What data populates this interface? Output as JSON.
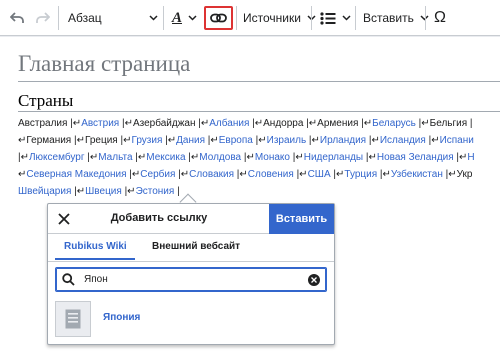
{
  "toolbar": {
    "undo_icon": "undo-arrow",
    "redo_icon": "redo-arrow",
    "format_label": "Абзац",
    "text_style_icon": "text-style-A",
    "link_icon": "link",
    "cite_label": "Источники",
    "list_icon": "bullet-list",
    "insert_label": "Вставить",
    "special_char_label": "Ω",
    "highlight_color": "#d33"
  },
  "page": {
    "title": "Главная страница",
    "section_heading": "Страны",
    "link_color": "#3366cc",
    "lines": [
      [
        {
          "t": "Австралия",
          "k": "dark"
        },
        {
          "t": " |↵",
          "k": "sep"
        },
        {
          "t": "Австрия",
          "k": "link"
        },
        {
          "t": " |↵",
          "k": "sep"
        },
        {
          "t": "Азербайджан",
          "k": "dark"
        },
        {
          "t": " |↵",
          "k": "sep"
        },
        {
          "t": "Албания",
          "k": "link"
        },
        {
          "t": " |↵",
          "k": "sep"
        },
        {
          "t": "Андорра",
          "k": "dark"
        },
        {
          "t": " |↵",
          "k": "sep"
        },
        {
          "t": "Армения",
          "k": "dark"
        },
        {
          "t": " |↵",
          "k": "sep"
        },
        {
          "t": "Беларусь",
          "k": "link"
        },
        {
          "t": " |↵",
          "k": "sep"
        },
        {
          "t": "Бельгия",
          "k": "dark"
        },
        {
          "t": " |",
          "k": "sep"
        }
      ],
      [
        {
          "t": "↵",
          "k": "sep"
        },
        {
          "t": "Германия",
          "k": "dark"
        },
        {
          "t": " |↵",
          "k": "sep"
        },
        {
          "t": "Греция",
          "k": "dark"
        },
        {
          "t": " |↵",
          "k": "sep"
        },
        {
          "t": "Грузия",
          "k": "link"
        },
        {
          "t": " |↵",
          "k": "sep"
        },
        {
          "t": "Дания",
          "k": "link"
        },
        {
          "t": " |↵",
          "k": "sep"
        },
        {
          "t": "Европа",
          "k": "link"
        },
        {
          "t": " |↵",
          "k": "sep"
        },
        {
          "t": "Израиль",
          "k": "link"
        },
        {
          "t": " |↵",
          "k": "sep"
        },
        {
          "t": "Ирландия",
          "k": "link"
        },
        {
          "t": " |↵",
          "k": "sep"
        },
        {
          "t": "Исландия",
          "k": "link"
        },
        {
          "t": " |↵",
          "k": "sep"
        },
        {
          "t": "Испани",
          "k": "link"
        }
      ],
      [
        {
          "t": " |↵",
          "k": "sep"
        },
        {
          "t": "Люксембург",
          "k": "link"
        },
        {
          "t": " |↵",
          "k": "sep"
        },
        {
          "t": "Мальта",
          "k": "link"
        },
        {
          "t": " |↵",
          "k": "sep"
        },
        {
          "t": "Мексика",
          "k": "link"
        },
        {
          "t": " |↵",
          "k": "sep"
        },
        {
          "t": "Молдова",
          "k": "link"
        },
        {
          "t": " |↵",
          "k": "sep"
        },
        {
          "t": "Монако",
          "k": "link"
        },
        {
          "t": " |↵",
          "k": "sep"
        },
        {
          "t": "Нидерланды",
          "k": "link"
        },
        {
          "t": " |↵",
          "k": "sep"
        },
        {
          "t": "Новая Зеландия",
          "k": "link"
        },
        {
          "t": " |↵",
          "k": "sep"
        },
        {
          "t": "Н",
          "k": "link"
        }
      ],
      [
        {
          "t": "↵",
          "k": "sep"
        },
        {
          "t": "Северная Македония",
          "k": "link"
        },
        {
          "t": " |↵",
          "k": "sep"
        },
        {
          "t": "Сербия",
          "k": "link"
        },
        {
          "t": " |↵",
          "k": "sep"
        },
        {
          "t": "Словакия",
          "k": "link"
        },
        {
          "t": " |↵",
          "k": "sep"
        },
        {
          "t": "Словения",
          "k": "link"
        },
        {
          "t": " |↵",
          "k": "sep"
        },
        {
          "t": "США",
          "k": "link"
        },
        {
          "t": " |↵",
          "k": "sep"
        },
        {
          "t": "Турция",
          "k": "link"
        },
        {
          "t": " |↵",
          "k": "sep"
        },
        {
          "t": "Узбекистан",
          "k": "link"
        },
        {
          "t": " |↵",
          "k": "sep"
        },
        {
          "t": "Укр",
          "k": "dark"
        }
      ],
      [
        {
          "t": "Швейцария",
          "k": "link"
        },
        {
          "t": " |↵",
          "k": "sep"
        },
        {
          "t": "Швеция",
          "k": "link"
        },
        {
          "t": " |↵",
          "k": "sep"
        },
        {
          "t": "Эстония",
          "k": "link"
        },
        {
          "t": " |",
          "k": "sep"
        }
      ]
    ]
  },
  "dialog": {
    "title": "Добавить ссылку",
    "insert_button": "Вставить",
    "tabs": [
      "Rubikus Wiki",
      "Внешний вебсайт"
    ],
    "active_tab": "Rubikus Wiki",
    "search_value": "Япон",
    "accent_color": "#3366cc",
    "results": [
      {
        "title": "Япония",
        "icon": "article-page-icon"
      }
    ]
  }
}
